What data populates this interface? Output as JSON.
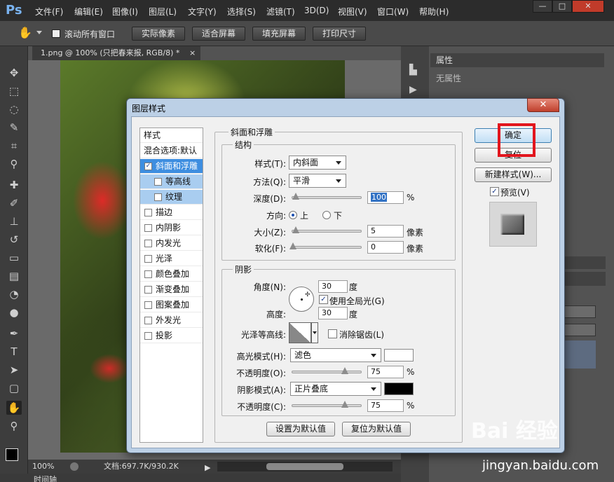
{
  "app": {
    "logo": "Ps",
    "menu": [
      "文件(F)",
      "编辑(E)",
      "图像(I)",
      "图层(L)",
      "文字(Y)",
      "选择(S)",
      "滤镜(T)",
      "3D(D)",
      "视图(V)",
      "窗口(W)",
      "帮助(H)"
    ],
    "window_controls": [
      "—",
      "□",
      "✕"
    ]
  },
  "options_bar": {
    "scroll_all_label": "滚动所有窗口",
    "buttons": [
      "实际像素",
      "适合屏幕",
      "填充屏幕",
      "打印尺寸"
    ]
  },
  "document": {
    "tab_title": "1.png @ 100% (只把春来报, RGB/8) *",
    "zoom": "100%",
    "doc_info": "文档:697.7K/930.2K",
    "timeline_tab": "时间轴"
  },
  "properties_panel": {
    "tab": "属性",
    "empty_text": "无属性"
  },
  "dialog": {
    "title": "图层样式",
    "close": "✕",
    "styles_header": "样式",
    "blend_options": "混合选项:默认",
    "style_items": [
      {
        "label": "斜面和浮雕",
        "checked": true,
        "selected": true,
        "indent": false
      },
      {
        "label": "等高线",
        "checked": false,
        "selected": false,
        "indent": true
      },
      {
        "label": "纹理",
        "checked": false,
        "selected": false,
        "indent": true
      },
      {
        "label": "描边",
        "checked": false,
        "selected": false,
        "indent": false
      },
      {
        "label": "内阴影",
        "checked": false,
        "selected": false,
        "indent": false
      },
      {
        "label": "内发光",
        "checked": false,
        "selected": false,
        "indent": false
      },
      {
        "label": "光泽",
        "checked": false,
        "selected": false,
        "indent": false
      },
      {
        "label": "颜色叠加",
        "checked": false,
        "selected": false,
        "indent": false
      },
      {
        "label": "渐变叠加",
        "checked": false,
        "selected": false,
        "indent": false
      },
      {
        "label": "图案叠加",
        "checked": false,
        "selected": false,
        "indent": false
      },
      {
        "label": "外发光",
        "checked": false,
        "selected": false,
        "indent": false
      },
      {
        "label": "投影",
        "checked": false,
        "selected": false,
        "indent": false
      }
    ],
    "bevel": {
      "section_title": "斜面和浮雕",
      "structure_title": "结构",
      "style_label": "样式(T):",
      "style_value": "内斜面",
      "technique_label": "方法(Q):",
      "technique_value": "平滑",
      "depth_label": "深度(D):",
      "depth_value": "100",
      "depth_unit": "%",
      "direction_label": "方向:",
      "direction_up": "上",
      "direction_down": "下",
      "size_label": "大小(Z):",
      "size_value": "5",
      "size_unit": "像素",
      "soften_label": "软化(F):",
      "soften_value": "0",
      "soften_unit": "像素"
    },
    "shading": {
      "title": "阴影",
      "angle_label": "角度(N):",
      "angle_value": "30",
      "angle_unit": "度",
      "global_light_label": "使用全局光(G)",
      "altitude_label": "高度:",
      "altitude_value": "30",
      "altitude_unit": "度",
      "gloss_label": "光泽等高线:",
      "antialias_label": "消除锯齿(L)",
      "highlight_mode_label": "高光模式(H):",
      "highlight_mode_value": "滤色",
      "highlight_color": "#ffffff",
      "highlight_opacity_label": "不透明度(O):",
      "highlight_opacity_value": "75",
      "shadow_mode_label": "阴影模式(A):",
      "shadow_mode_value": "正片叠底",
      "shadow_color": "#000000",
      "shadow_opacity_label": "不透明度(C):",
      "shadow_opacity_value": "75",
      "percent": "%"
    },
    "bottom_buttons": [
      "设置为默认值",
      "复位为默认值"
    ],
    "side_buttons": {
      "ok": "确定",
      "reset": "复位",
      "new_style": "新建样式(W)...",
      "preview_label": "预览(V)"
    }
  },
  "watermark": {
    "brand": "Bai 经验",
    "url": "jingyan.baidu.com"
  }
}
